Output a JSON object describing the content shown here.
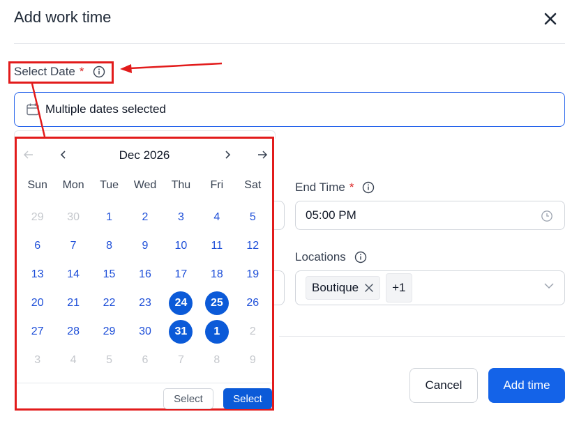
{
  "dialog": {
    "title": "Add work time",
    "close_icon": "close-icon"
  },
  "select_date": {
    "label": "Select Date",
    "required_mark": "*",
    "value": "Multiple dates selected"
  },
  "end_time": {
    "label": "End Time",
    "required_mark": "*",
    "value": "05:00 PM"
  },
  "locations": {
    "label": "Locations",
    "chip": "Boutique",
    "more": "+1"
  },
  "calendar": {
    "month_label": "Dec 2026",
    "weekdays": [
      "Sun",
      "Mon",
      "Tue",
      "Wed",
      "Thu",
      "Fri",
      "Sat"
    ],
    "weeks": [
      [
        {
          "d": "29",
          "m": true
        },
        {
          "d": "30",
          "m": true
        },
        {
          "d": "1"
        },
        {
          "d": "2"
        },
        {
          "d": "3"
        },
        {
          "d": "4"
        },
        {
          "d": "5"
        }
      ],
      [
        {
          "d": "6"
        },
        {
          "d": "7"
        },
        {
          "d": "8"
        },
        {
          "d": "9"
        },
        {
          "d": "10"
        },
        {
          "d": "11"
        },
        {
          "d": "12"
        }
      ],
      [
        {
          "d": "13"
        },
        {
          "d": "14"
        },
        {
          "d": "15"
        },
        {
          "d": "16"
        },
        {
          "d": "17"
        },
        {
          "d": "18"
        },
        {
          "d": "19"
        }
      ],
      [
        {
          "d": "20"
        },
        {
          "d": "21"
        },
        {
          "d": "22"
        },
        {
          "d": "23"
        },
        {
          "d": "24",
          "s": true
        },
        {
          "d": "25",
          "s": true
        },
        {
          "d": "26"
        }
      ],
      [
        {
          "d": "27"
        },
        {
          "d": "28"
        },
        {
          "d": "29"
        },
        {
          "d": "30"
        },
        {
          "d": "31",
          "s": true
        },
        {
          "d": "1",
          "s": true
        },
        {
          "d": "2",
          "m": true
        }
      ],
      [
        {
          "d": "3",
          "m": true
        },
        {
          "d": "4",
          "m": true
        },
        {
          "d": "5",
          "m": true
        },
        {
          "d": "6",
          "m": true
        },
        {
          "d": "7",
          "m": true
        },
        {
          "d": "8",
          "m": true
        },
        {
          "d": "9",
          "m": true
        }
      ]
    ],
    "footer_secondary": "Select",
    "footer_primary": "Select"
  },
  "actions": {
    "cancel": "Cancel",
    "add": "Add time"
  },
  "colors": {
    "accent": "#1463e8",
    "selected_day": "#0b5ad8",
    "annotation": "#e21b1b",
    "required": "#dc2626"
  }
}
